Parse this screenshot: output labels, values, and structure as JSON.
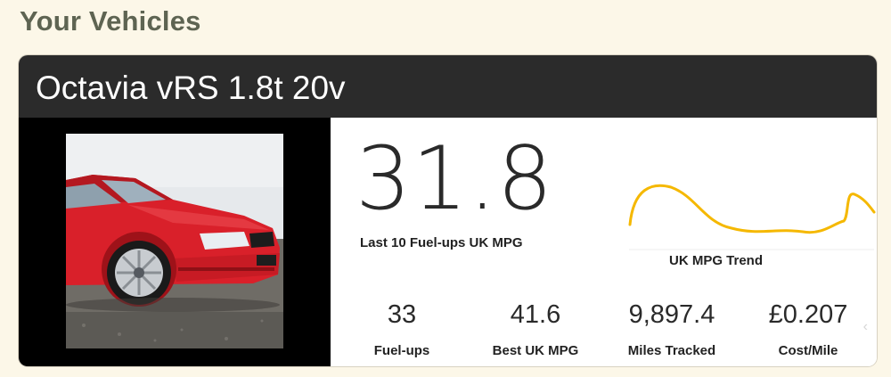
{
  "page": {
    "title": "Your Vehicles"
  },
  "vehicle": {
    "name": "Octavia vRS 1.8t 20v",
    "photo_icon": "red-car-photo",
    "primary_stat": {
      "value": "31.8",
      "label": "Last 10 Fuel-ups UK MPG"
    },
    "trend": {
      "label": "UK MPG Trend",
      "color": "#f5b800"
    },
    "stats": [
      {
        "value": "33",
        "label": "Fuel-ups"
      },
      {
        "value": "41.6",
        "label": "Best UK MPG"
      },
      {
        "value": "9,897.4",
        "label": "Miles Tracked"
      },
      {
        "value": "£0.207",
        "label": "Cost/Mile"
      }
    ],
    "next_icon": "chevron-right-icon"
  },
  "colors": {
    "background": "#fcf7e8",
    "header": "#2b2b2b",
    "title": "#5e6452",
    "trend_line": "#f5b800"
  }
}
